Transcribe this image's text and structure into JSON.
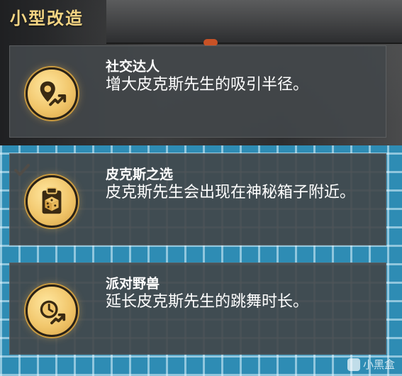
{
  "screen": {
    "title": "小型改造"
  },
  "mods": [
    {
      "name": "社交达人",
      "description": "增大皮克斯先生的吸引半径。",
      "icon": "map-pin-growth-icon",
      "selected": false
    },
    {
      "name": "皮克斯之选",
      "description": "皮克斯先生会出现在神秘箱子附近。",
      "icon": "clipboard-dice-icon",
      "selected": true
    },
    {
      "name": "派对野兽",
      "description": "延长皮克斯先生的跳舞时长。",
      "icon": "clock-growth-icon",
      "selected": false
    }
  ],
  "colors": {
    "title": "#f3d483",
    "badge_gold": "#f1c66b",
    "check_orange": "#e8892b",
    "card_bg": "#42464a"
  },
  "watermark": {
    "text": "小黑盒"
  }
}
